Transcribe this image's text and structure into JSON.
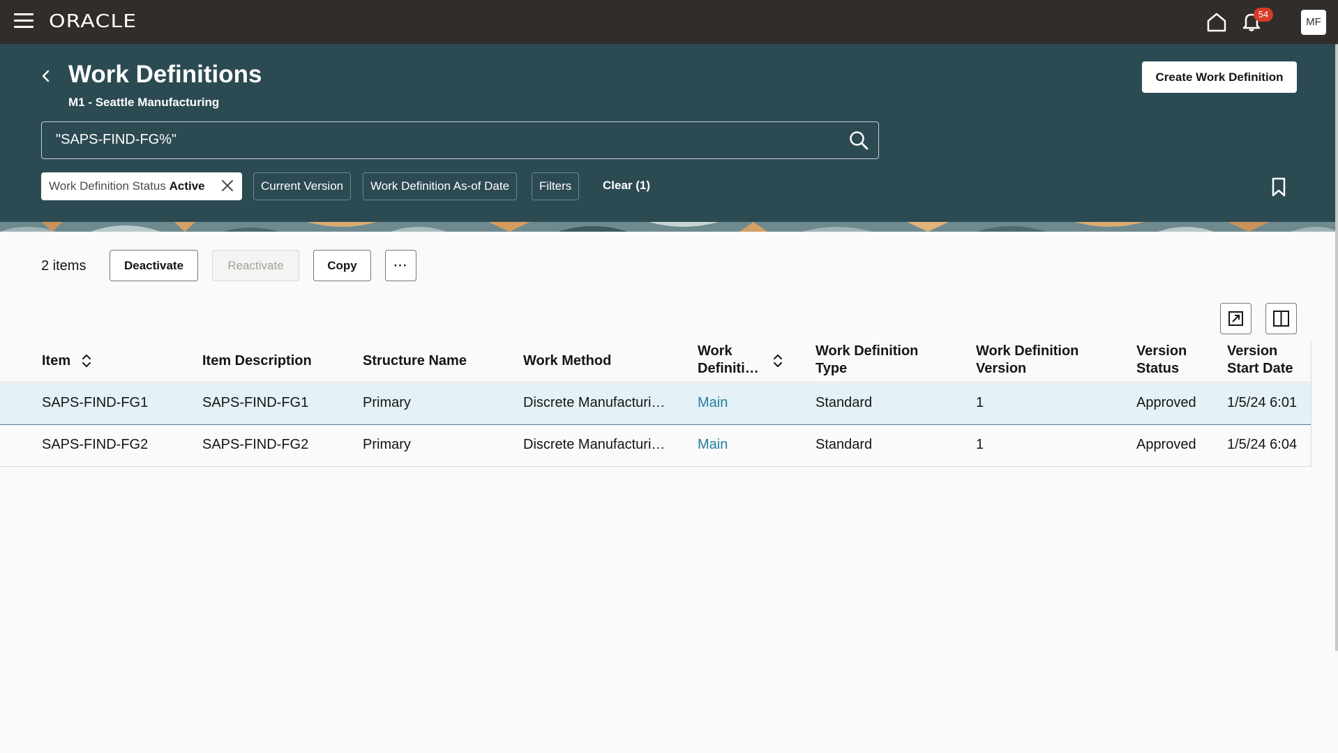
{
  "topbar": {
    "logo": "ORACLE",
    "notifications_count": "54",
    "user_initials": "MF"
  },
  "header": {
    "title": "Work Definitions",
    "subtitle": "M1 - Seattle Manufacturing",
    "create_button": "Create Work Definition",
    "search_value": "\"SAPS-FIND-FG%\"",
    "filters": {
      "status_label": "Work Definition Status",
      "status_value": "Active",
      "current_version": "Current Version",
      "as_of_date": "Work Definition As-of Date",
      "filters": "Filters",
      "clear": "Clear (1)"
    }
  },
  "toolbar": {
    "items_count": "2 items",
    "deactivate": "Deactivate",
    "reactivate": "Reactivate",
    "copy": "Copy",
    "more": "···"
  },
  "table": {
    "headers": {
      "item": "Item",
      "item_description": "Item Description",
      "structure_name": "Structure Name",
      "work_method": "Work Method",
      "work_definition_line1": "Work",
      "work_definition_line2": "Definiti…",
      "type_line1": "Work Definition",
      "type_line2": "Type",
      "version_line1": "Work Definition",
      "version_line2": "Version",
      "status_line1": "Version",
      "status_line2": "Status",
      "start_line1": "Version",
      "start_line2": "Start Date"
    },
    "rows": [
      {
        "item": "SAPS-FIND-FG1",
        "item_description": "SAPS-FIND-FG1",
        "structure_name": "Primary",
        "work_method": "Discrete Manufacturi…",
        "work_definition": "Main",
        "type": "Standard",
        "version": "1",
        "status": "Approved",
        "start_date": "1/5/24 6:01"
      },
      {
        "item": "SAPS-FIND-FG2",
        "item_description": "SAPS-FIND-FG2",
        "structure_name": "Primary",
        "work_method": "Discrete Manufacturi…",
        "work_definition": "Main",
        "type": "Standard",
        "version": "1",
        "status": "Approved",
        "start_date": "1/5/24 6:04"
      }
    ]
  }
}
